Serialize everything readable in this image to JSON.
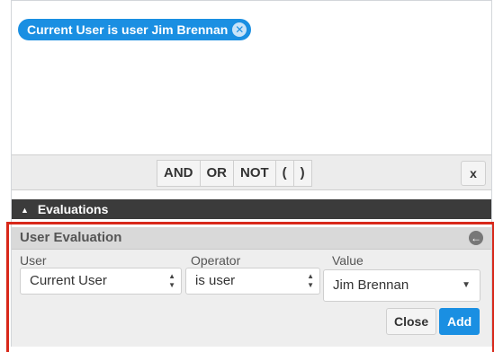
{
  "canvas": {
    "tags": [
      {
        "label": "Current User is user Jim Brennan",
        "remove_icon": "circle-x-icon"
      }
    ]
  },
  "toolbar": {
    "operators": [
      "AND",
      "OR",
      "NOT",
      "(",
      ")"
    ],
    "close_label": "x"
  },
  "evaluations": {
    "header_label": "Evaluations",
    "toggle_icon": "triangle-up-icon"
  },
  "user_evaluation": {
    "title": "User Evaluation",
    "back_icon": "circle-arrow-left-icon",
    "fields": {
      "user": {
        "label": "User",
        "value": "Current User"
      },
      "operator": {
        "label": "Operator",
        "value": "is user"
      },
      "value": {
        "label": "Value",
        "value": "Jim Brennan"
      }
    },
    "close_button": "Close",
    "add_button": "Add"
  },
  "colors": {
    "accent": "#1a8fe2",
    "highlight_border": "#d8281a",
    "evaluations_bar": "#3b3b3b"
  }
}
